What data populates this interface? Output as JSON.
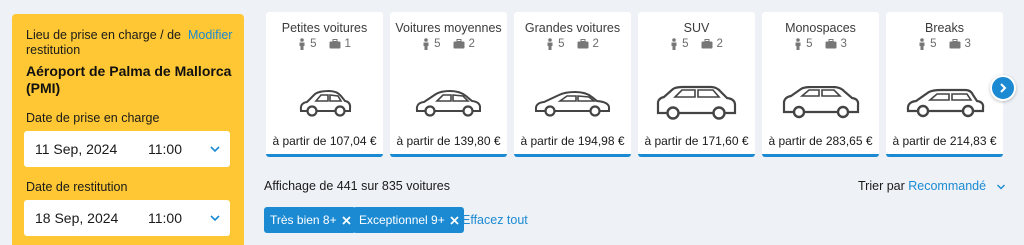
{
  "search": {
    "location_label": "Lieu de prise en charge / de restitution",
    "modify_link": "Modifier",
    "location_name": "Aéroport de Palma de Mallorca (PMI)",
    "pickup_label": "Date de prise en charge",
    "pickup_date": "11 Sep, 2024",
    "pickup_time": "11:00",
    "return_label": "Date de restitution",
    "return_date": "18 Sep, 2024",
    "return_time": "11:00"
  },
  "categories": [
    {
      "name": "Petites voitures",
      "passengers": "5",
      "bags": "1",
      "price": "à partir de 107,04 €",
      "icon": "small-car-icon"
    },
    {
      "name": "Voitures moyennes",
      "passengers": "5",
      "bags": "2",
      "price": "à partir de 139,80 €",
      "icon": "medium-car-icon"
    },
    {
      "name": "Grandes voitures",
      "passengers": "5",
      "bags": "2",
      "price": "à partir de 194,98 €",
      "icon": "large-car-icon"
    },
    {
      "name": "SUV",
      "passengers": "5",
      "bags": "2",
      "price": "à partir de 171,60 €",
      "icon": "suv-icon"
    },
    {
      "name": "Monospaces",
      "passengers": "5",
      "bags": "3",
      "price": "à partir de 283,65 €",
      "icon": "minivan-icon"
    },
    {
      "name": "Breaks",
      "passengers": "5",
      "bags": "3",
      "price": "à partir de 214,83 €",
      "icon": "estate-car-icon"
    }
  ],
  "results": {
    "count_text": "Affichage de 441 sur 835 voitures",
    "sort_label": "Trier par",
    "sort_value": "Recommandé"
  },
  "filters": {
    "chips": [
      "Très bien 8+",
      "Exceptionnel 9+"
    ],
    "clear_all": "Effacez tout"
  },
  "colors": {
    "panel_yellow": "#fec733",
    "accent_blue": "#1b8ad3",
    "background": "#eef1f6"
  }
}
